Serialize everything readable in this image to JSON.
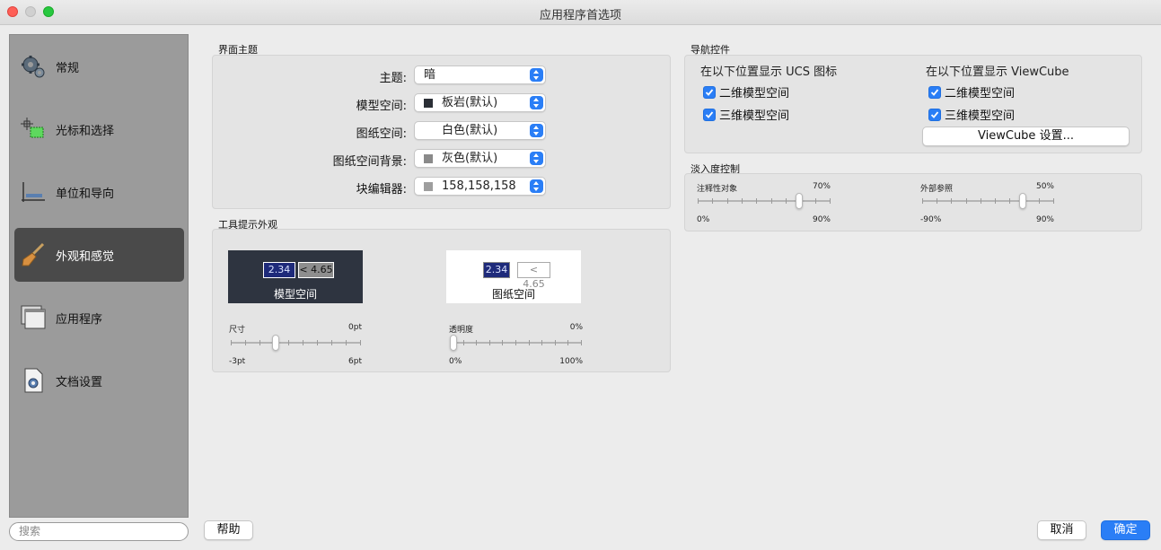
{
  "window": {
    "title": "应用程序首选项"
  },
  "sidebar": {
    "items": [
      {
        "label": "常规",
        "icon": "gears-icon"
      },
      {
        "label": "光标和选择",
        "icon": "cursor-selection-icon"
      },
      {
        "label": "单位和导向",
        "icon": "units-ruler-icon"
      },
      {
        "label": "外观和感觉",
        "icon": "paint-brush-icon",
        "active": true
      },
      {
        "label": "应用程序",
        "icon": "application-windows-icon"
      },
      {
        "label": "文档设置",
        "icon": "document-settings-icon"
      }
    ],
    "search_placeholder": "搜索"
  },
  "interface_theme": {
    "title": "界面主题",
    "rows": [
      {
        "label": "主题:",
        "value": "暗",
        "swatch": null
      },
      {
        "label": "模型空间:",
        "value": "板岩(默认)",
        "swatch": "#2b2f36"
      },
      {
        "label": "图纸空间:",
        "value": "白色(默认)",
        "swatch": "#ffffff"
      },
      {
        "label": "图纸空间背景:",
        "value": "灰色(默认)",
        "swatch": "#8a8a8a"
      },
      {
        "label": "块编辑器:",
        "value": "158,158,158",
        "swatch": "#9e9e9e"
      }
    ]
  },
  "tooltip_appearance": {
    "title": "工具提示外观",
    "preview_model": {
      "value1": "2.34",
      "value2": "< 4.65",
      "label": "模型空间"
    },
    "preview_paper": {
      "value1": "2.34",
      "value2": "< 4.65",
      "label": "图纸空间"
    },
    "size_slider": {
      "label": "尺寸",
      "current": "0pt",
      "min": "-3pt",
      "max": "6pt",
      "level": 0.333
    },
    "transparency_slider": {
      "label": "透明度",
      "current": "0%",
      "min": "0%",
      "max": "100%",
      "level": 0.0
    }
  },
  "navigation": {
    "title": "导航控件",
    "ucs": {
      "heading": "在以下位置显示 UCS 图标",
      "options": [
        {
          "label": "二维模型空间",
          "checked": true
        },
        {
          "label": "三维模型空间",
          "checked": true
        }
      ]
    },
    "viewcube": {
      "heading": "在以下位置显示 ViewCube",
      "options": [
        {
          "label": "二维模型空间",
          "checked": true
        },
        {
          "label": "三维模型空间",
          "checked": true
        }
      ],
      "settings_button": "ViewCube 设置..."
    }
  },
  "fade_control": {
    "title": "淡入度控制",
    "annotative": {
      "label": "注释性对象",
      "current": "70%",
      "min": "0%",
      "max": "90%",
      "level": 0.778
    },
    "xref": {
      "label": "外部参照",
      "current": "50%",
      "min": "-90%",
      "max": "90%",
      "level": 0.778
    }
  },
  "footer": {
    "help": "帮助",
    "cancel": "取消",
    "ok": "确定"
  },
  "colors": {
    "accent": "#2a7ef6",
    "sidebar_bg": "#9b9b9b",
    "sidebar_active": "#4a4a4a",
    "preview_dark": "#2e3440"
  }
}
